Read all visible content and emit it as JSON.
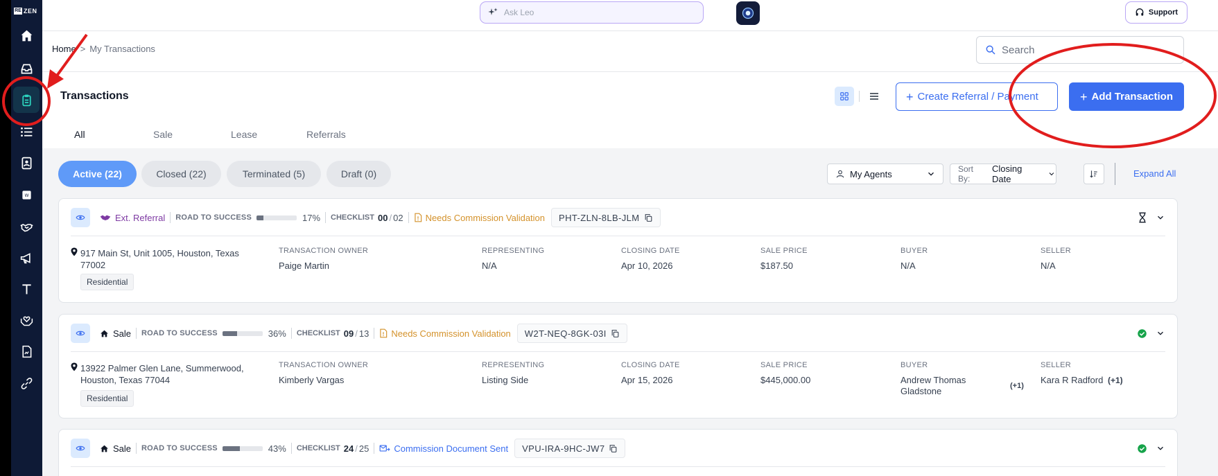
{
  "sidebar": {
    "logo_text": "ZEN",
    "logo_box": "RE",
    "items": [
      {
        "icon": "home-icon"
      },
      {
        "icon": "inbox-icon"
      },
      {
        "icon": "clipboard-icon",
        "active": true
      },
      {
        "icon": "list-icon"
      },
      {
        "icon": "contacts-icon"
      },
      {
        "icon": "badge-icon"
      },
      {
        "icon": "handshake-icon"
      },
      {
        "icon": "megaphone-icon"
      },
      {
        "icon": "text-icon"
      },
      {
        "icon": "support-hands-icon"
      },
      {
        "icon": "document-icon"
      },
      {
        "icon": "link-icon"
      }
    ]
  },
  "topbar": {
    "ask_placeholder": "Ask Leo",
    "support_label": "Support"
  },
  "breadcrumb": {
    "home": "Home",
    "separator": ">",
    "current": "My Transactions"
  },
  "search": {
    "placeholder": "Search"
  },
  "page": {
    "title": "Transactions",
    "create_referral_label": "Create Referral / Payment",
    "add_transaction_label": "Add Transaction"
  },
  "type_tabs": [
    "All",
    "Sale",
    "Lease",
    "Referrals"
  ],
  "status_pills": [
    "Active (22)",
    "Closed (22)",
    "Terminated (5)",
    "Draft (0)"
  ],
  "filters": {
    "agents_label": "My Agents",
    "sort_label": "Sort By:",
    "sort_value": "Closing Date",
    "expand_all": "Expand All"
  },
  "labels": {
    "road_to_success": "ROAD TO SUCCESS",
    "checklist": "CHECKLIST",
    "owner": "TRANSACTION OWNER",
    "representing": "REPRESENTING",
    "closing_date": "CLOSING DATE",
    "sale_price": "SALE PRICE",
    "buyer": "BUYER",
    "seller": "SELLER"
  },
  "transactions": [
    {
      "type": "Ext. Referral",
      "progress_pct": "17%",
      "progress": 0.17,
      "checklist_done": "00",
      "checklist_total": "02",
      "status": "Needs Commission Validation",
      "code": "PHT-ZLN-8LB-JLM",
      "address_1": "917 Main St, Unit 1005, Houston, Texas",
      "address_2": "77002",
      "tag": "Residential",
      "owner": "Paige Martin",
      "representing": "N/A",
      "closing_date": "Apr 10, 2026",
      "sale_price": "$187.50",
      "buyer": "N/A",
      "seller": "N/A",
      "right_icon": "hourglass-icon"
    },
    {
      "type": "Sale",
      "progress_pct": "36%",
      "progress": 0.36,
      "checklist_done": "09",
      "checklist_total": "13",
      "status": "Needs Commission Validation",
      "code": "W2T-NEQ-8GK-03I",
      "address_1": "13922 Palmer Glen Lane, Summerwood,",
      "address_2": "Houston, Texas 77044",
      "tag": "Residential",
      "owner": "Kimberly Vargas",
      "representing": "Listing Side",
      "closing_date": "Apr 15, 2026",
      "sale_price": "$445,000.00",
      "buyer_1": "Andrew Thomas",
      "buyer_2": "Gladstone",
      "buyer_plus": "(+1)",
      "seller": "Kara R Radford",
      "seller_plus": "(+1)",
      "right_icon": "check-circle-icon"
    },
    {
      "type": "Sale",
      "progress_pct": "43%",
      "progress": 0.43,
      "checklist_done": "24",
      "checklist_total": "25",
      "status": "Commission Document Sent",
      "code": "VPU-IRA-9HC-JW7",
      "right_icon": "check-circle-icon"
    }
  ]
}
